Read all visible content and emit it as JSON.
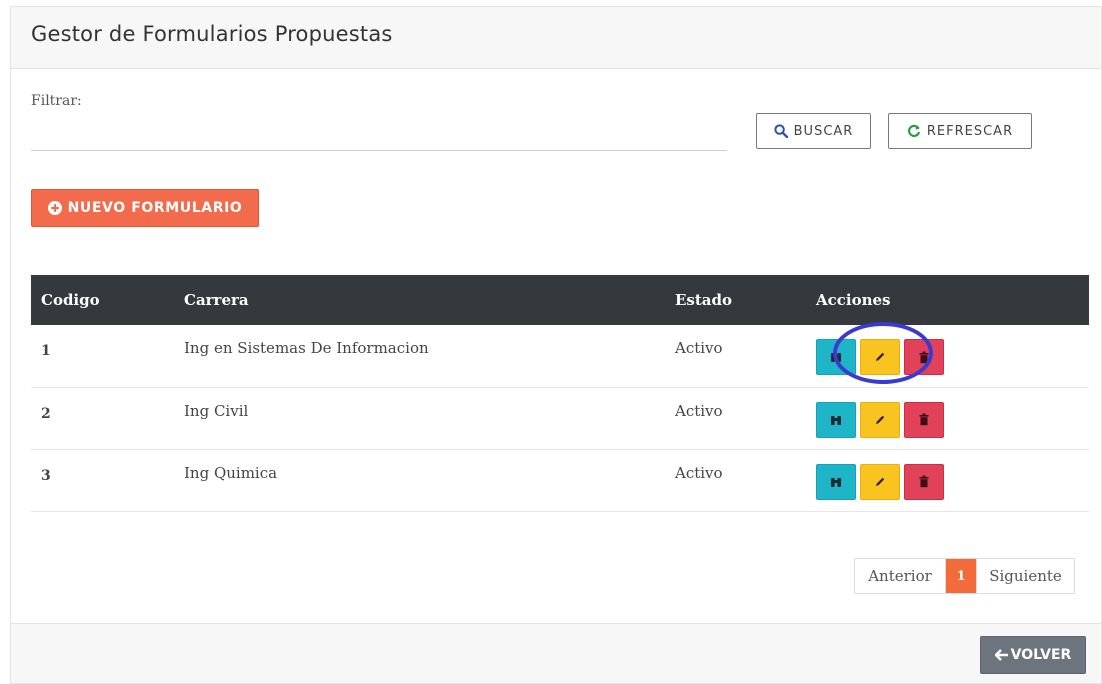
{
  "title": "Gestor de Formularios Propuestas",
  "filter": {
    "label": "Filtrar:",
    "value": "",
    "placeholder": ""
  },
  "buttons": {
    "buscar": "BUSCAR",
    "refrescar": "REFRESCAR",
    "nuevo": "NUEVO FORMULARIO",
    "volver": "VOLVER"
  },
  "table": {
    "headers": [
      "Codigo",
      "Carrera",
      "Estado",
      "Acciones"
    ],
    "rows": [
      {
        "codigo": "1",
        "carrera": "Ing en Sistemas De Informacion",
        "estado": "Activo"
      },
      {
        "codigo": "2",
        "carrera": "Ing Civil",
        "estado": "Activo"
      },
      {
        "codigo": "3",
        "carrera": "Ing Quimica",
        "estado": "Activo"
      }
    ]
  },
  "pagination": {
    "prev": "Anterior",
    "current": "1",
    "next": "Siguiente"
  },
  "icons": [
    "search-icon",
    "refresh-icon",
    "plus-circle-icon",
    "binoculars-icon",
    "pencil-icon",
    "trash-icon",
    "arrow-left-icon"
  ],
  "colors": {
    "accent": "#f26b4d",
    "header_bg": "#35393d",
    "view": "#1fb5c8",
    "edit": "#f9c320",
    "delete": "#e2415a",
    "volver": "#6c757d",
    "highlight_ring": "#3a3ad1"
  }
}
